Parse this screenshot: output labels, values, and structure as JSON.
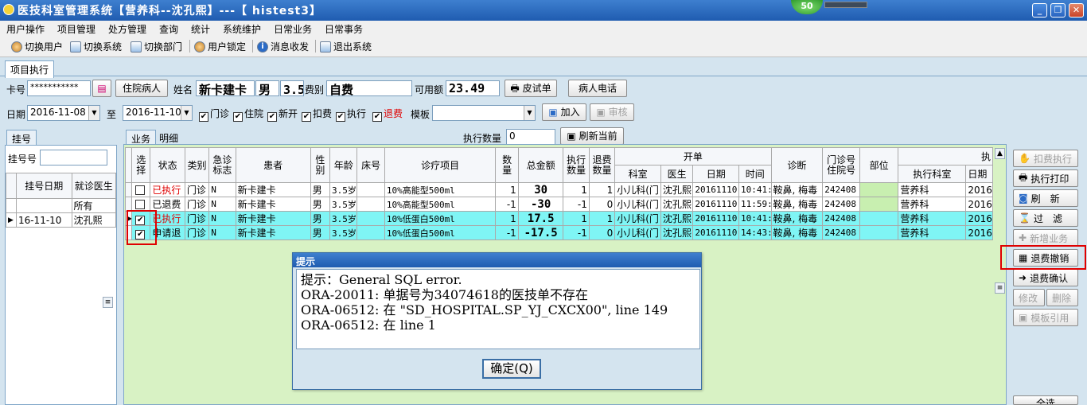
{
  "window": {
    "title": "医技科室管理系统【营养科--沈孔熙】---【 histest3】",
    "badge": "50"
  },
  "menu": [
    "用户操作",
    "项目管理",
    "处方管理",
    "查询",
    "统计",
    "系统维护",
    "日常业务",
    "日常事务"
  ],
  "toolbar": [
    "切换用户",
    "切换系统",
    "切换部门",
    "用户锁定",
    "消息收发",
    "退出系统"
  ],
  "tabs": {
    "main": "项目执行",
    "left": "挂号",
    "business": "业务",
    "detail": "明细"
  },
  "patient": {
    "card_label": "卡号",
    "card_value": "***********",
    "inpatient_btn": "住院病人",
    "name_label": "姓名",
    "name": "新卡建卡",
    "sex": "男",
    "age": "3.5岁",
    "fee_label": "费别",
    "fee": "自费",
    "balance_label": "可用额",
    "balance": "23.49",
    "skin_test_btn": "皮试单",
    "phone_btn": "病人电话"
  },
  "filter": {
    "date_label": "日期",
    "date_from": "2016-11-08",
    "to_label": "至",
    "date_to": "2016-11-10",
    "checks": [
      {
        "label": "门诊",
        "checked": true
      },
      {
        "label": "住院",
        "checked": true
      },
      {
        "label": "新开",
        "checked": true
      },
      {
        "label": "扣费",
        "checked": true
      },
      {
        "label": "执行",
        "checked": true
      },
      {
        "label": "退费",
        "checked": true
      }
    ],
    "template_label": "模板",
    "add_btn": "加入",
    "review_btn": "审核"
  },
  "exec": {
    "qty_label": "执行数量",
    "qty_value": "0",
    "refresh_btn": "刷新当前"
  },
  "left": {
    "reg_no_label": "挂号号",
    "reg_no_value": "",
    "headers": [
      "挂号日期",
      "就诊医生"
    ],
    "rows": [
      [
        "",
        "所有"
      ],
      [
        "16-11-10",
        "沈孔熙"
      ]
    ]
  },
  "table": {
    "headers": [
      "选择",
      "状态",
      "类别",
      "急诊标志",
      "患者",
      "性别",
      "年龄",
      "床号",
      "诊疗项目",
      "数量",
      "总金额",
      "执行数量",
      "退费数量",
      "开单",
      "科室",
      "医生",
      "日期",
      "时间",
      "诊断",
      "门诊号住院号",
      "部位",
      "执",
      "执行科室",
      "日期"
    ],
    "rows": [
      {
        "check": "",
        "status": "已执行",
        "type": "门诊",
        "urgent": "N",
        "patient": "新卡建卡",
        "sex": "男",
        "age": "3.5岁",
        "bed": "",
        "item": "10%高能型500ml",
        "qty": "1",
        "amount": "30",
        "exec": "1",
        "refund": "1",
        "dept": "小儿科(门",
        "doctor": "沈孔熙",
        "date": "20161110",
        "time": "10:41:",
        "diag": "鞍鼻, 梅毒",
        "opno": "242408",
        "part": "",
        "exec_dept": "营养科",
        "exec_date": "2016"
      },
      {
        "check": "",
        "status": "已退费",
        "type": "门诊",
        "urgent": "N",
        "patient": "新卡建卡",
        "sex": "男",
        "age": "3.5岁",
        "bed": "",
        "item": "10%高能型500ml",
        "qty": "-1",
        "amount": "-30",
        "exec": "-1",
        "refund": "0",
        "dept": "小儿科(门",
        "doctor": "沈孔熙",
        "date": "20161110",
        "time": "11:59:",
        "diag": "鞍鼻, 梅毒",
        "opno": "242408",
        "part": "",
        "exec_dept": "营养科",
        "exec_date": "2016"
      },
      {
        "check": "✔",
        "status": "已执行",
        "type": "门诊",
        "urgent": "N",
        "patient": "新卡建卡",
        "sex": "男",
        "age": "3.5岁",
        "bed": "",
        "item": "10%低蛋白500ml",
        "qty": "1",
        "amount": "17.5",
        "exec": "1",
        "refund": "1",
        "dept": "小儿科(门",
        "doctor": "沈孔熙",
        "date": "20161110",
        "time": "10:41:",
        "diag": "鞍鼻, 梅毒",
        "opno": "242408",
        "part": "",
        "exec_dept": "营养科",
        "exec_date": "2016"
      },
      {
        "check": "✔",
        "status": "申请退",
        "type": "门诊",
        "urgent": "N",
        "patient": "新卡建卡",
        "sex": "男",
        "age": "3.5岁",
        "bed": "",
        "item": "10%低蛋白500ml",
        "qty": "-1",
        "amount": "-17.5",
        "exec": "-1",
        "refund": "0",
        "dept": "小儿科(门",
        "doctor": "沈孔熙",
        "date": "20161110",
        "time": "14:43:",
        "diag": "鞍鼻, 梅毒",
        "opno": "242408",
        "part": "",
        "exec_dept": "营养科",
        "exec_date": "2016"
      }
    ]
  },
  "side_buttons": [
    {
      "label": "扣费执行",
      "enabled": false
    },
    {
      "label": "执行打印",
      "enabled": true
    },
    {
      "label": "刷　新",
      "enabled": true
    },
    {
      "label": "过　滤",
      "enabled": true
    },
    {
      "label": "新增业务",
      "enabled": false
    },
    {
      "label": "退费撤销",
      "enabled": true
    },
    {
      "label": "退费确认",
      "enabled": true
    },
    {
      "label": "修改",
      "enabled": false
    },
    {
      "label": "删除",
      "enabled": false
    },
    {
      "label": "模板引用",
      "enabled": false
    },
    {
      "label": "全选",
      "enabled": true
    }
  ],
  "dialog": {
    "title": "提示",
    "message": "提示：General SQL error.\nORA-20011: 单据号为34074618的医技单不存在\nORA-06512: 在 \"SD_HOSPITAL.SP_YJ_CXCX00\", line 149\nORA-06512: 在 line 1",
    "ok_btn": "确定(Q)"
  },
  "colors": {
    "title_bar": "#2a64c0",
    "highlight_row": "#7ff5f5",
    "grid_bg": "#d8f2c4",
    "annotation": "#e00000"
  }
}
